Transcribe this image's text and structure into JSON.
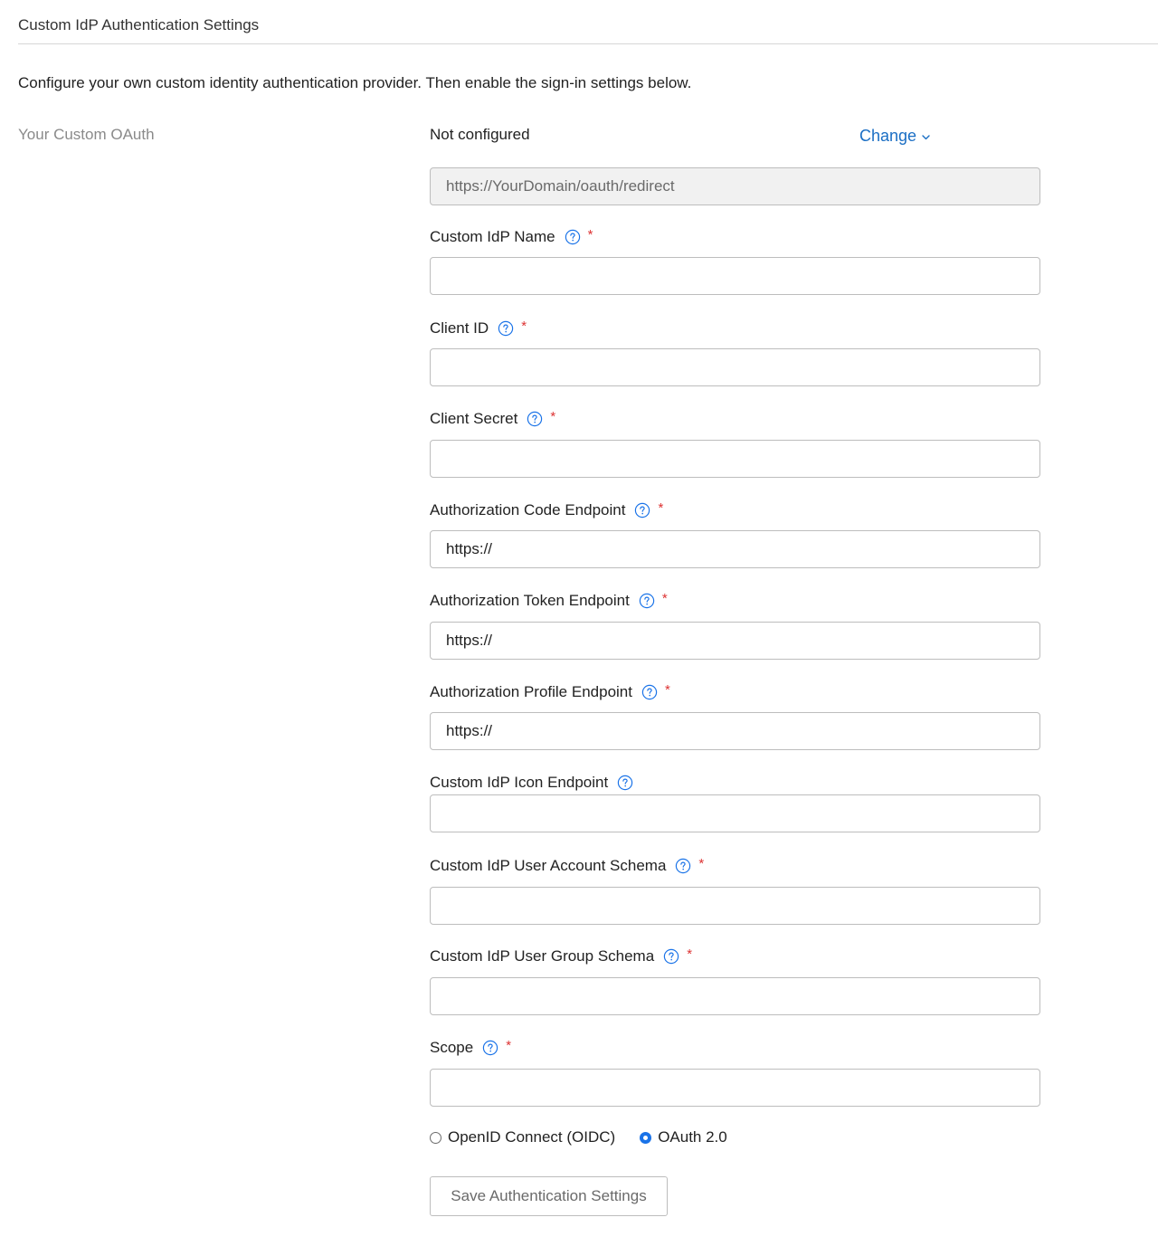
{
  "section": {
    "title": "Custom IdP Authentication Settings",
    "description": "Configure your own custom identity authentication provider. Then enable the sign-in settings below."
  },
  "oauth": {
    "side_label": "Your Custom OAuth",
    "status": "Not configured",
    "change_label": "Change",
    "redirect_url": "https://YourDomain/oauth/redirect"
  },
  "fields": {
    "idp_name": {
      "label": "Custom IdP Name",
      "value": "",
      "required": "*"
    },
    "client_id": {
      "label": "Client ID",
      "value": "",
      "required": "*"
    },
    "client_secret": {
      "label": "Client Secret",
      "value": "",
      "required": "*"
    },
    "auth_code_endpoint": {
      "label": "Authorization Code Endpoint",
      "value": "https://",
      "required": "*"
    },
    "auth_token_endpoint": {
      "label": "Authorization Token Endpoint",
      "value": "https://",
      "required": "*"
    },
    "auth_profile_endpoint": {
      "label": "Authorization Profile Endpoint",
      "value": "https://",
      "required": "*"
    },
    "icon_endpoint": {
      "label": "Custom IdP Icon Endpoint",
      "value": ""
    },
    "user_account_schema": {
      "label": "Custom IdP User Account Schema",
      "value": "",
      "required": "*"
    },
    "user_group_schema": {
      "label": "Custom IdP User Group Schema",
      "value": "",
      "required": "*"
    },
    "scope": {
      "label": "Scope",
      "value": "",
      "required": "*"
    }
  },
  "protocol": {
    "options": [
      {
        "label": "OpenID Connect (OIDC)",
        "checked": false
      },
      {
        "label": "OAuth 2.0",
        "checked": true
      }
    ]
  },
  "actions": {
    "save_label": "Save Authentication Settings"
  },
  "icons": {
    "help": "help-circle-icon",
    "chevron": "chevron-down-icon"
  },
  "colors": {
    "link": "#1a6ec4",
    "help_icon": "#1a73e8",
    "required": "#dd3333",
    "radio_checked": "#1a73e8"
  }
}
